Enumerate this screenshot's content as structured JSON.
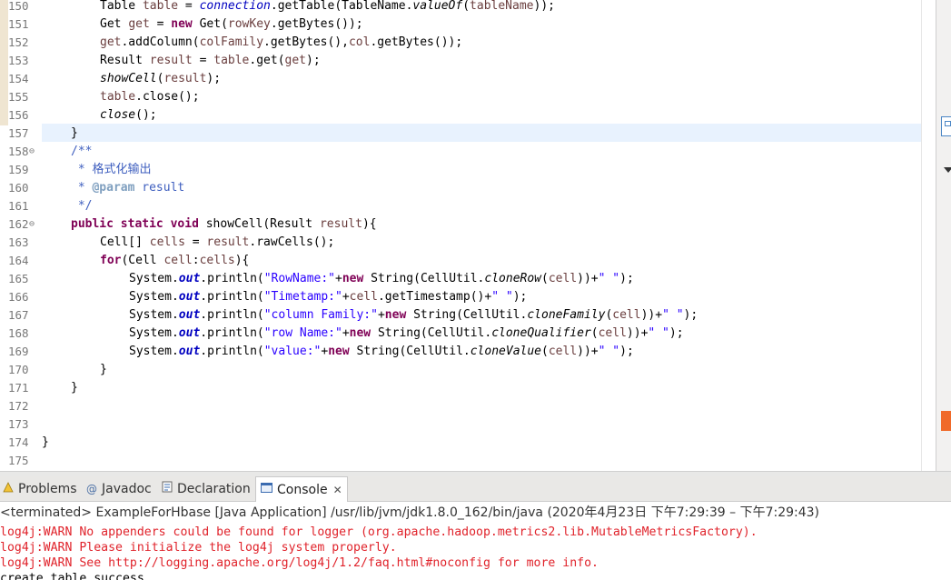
{
  "editor": {
    "lines": [
      {
        "n": "150",
        "fold": "",
        "indent": 2,
        "tokens": [
          [
            "Table ",
            "plain"
          ],
          [
            "table",
            "var"
          ],
          [
            " = ",
            "plain"
          ],
          [
            "connection",
            "static"
          ],
          [
            ".getTable(TableName.",
            "plain"
          ],
          [
            "valueOf",
            "italic"
          ],
          [
            "(",
            "plain"
          ],
          [
            "tableName",
            "var"
          ],
          [
            "));",
            "plain"
          ]
        ]
      },
      {
        "n": "151",
        "fold": "",
        "indent": 2,
        "tokens": [
          [
            "Get ",
            "plain"
          ],
          [
            "get",
            "var"
          ],
          [
            " = ",
            "plain"
          ],
          [
            "new",
            "kw"
          ],
          [
            " Get(",
            "plain"
          ],
          [
            "rowKey",
            "var"
          ],
          [
            ".getBytes());",
            "plain"
          ]
        ]
      },
      {
        "n": "152",
        "fold": "",
        "indent": 2,
        "tokens": [
          [
            "get",
            "var"
          ],
          [
            ".addColumn(",
            "plain"
          ],
          [
            "colFamily",
            "var"
          ],
          [
            ".getBytes(),",
            "plain"
          ],
          [
            "col",
            "var"
          ],
          [
            ".getBytes());",
            "plain"
          ]
        ]
      },
      {
        "n": "153",
        "fold": "",
        "indent": 2,
        "tokens": [
          [
            "Result ",
            "plain"
          ],
          [
            "result",
            "var"
          ],
          [
            " = ",
            "plain"
          ],
          [
            "table",
            "var"
          ],
          [
            ".get(",
            "plain"
          ],
          [
            "get",
            "var"
          ],
          [
            ");",
            "plain"
          ]
        ]
      },
      {
        "n": "154",
        "fold": "",
        "indent": 2,
        "tokens": [
          [
            "showCell",
            "italic"
          ],
          [
            "(",
            "plain"
          ],
          [
            "result",
            "var"
          ],
          [
            ");",
            "plain"
          ]
        ]
      },
      {
        "n": "155",
        "fold": "",
        "indent": 2,
        "tokens": [
          [
            "table",
            "var"
          ],
          [
            ".close();",
            "plain"
          ]
        ]
      },
      {
        "n": "156",
        "fold": "",
        "indent": 2,
        "tokens": [
          [
            "close",
            "italic"
          ],
          [
            "();",
            "plain"
          ]
        ]
      },
      {
        "n": "157",
        "fold": "",
        "indent": 1,
        "tokens": [
          [
            "}",
            "plain"
          ]
        ]
      },
      {
        "n": "158",
        "fold": "⊖",
        "indent": 1,
        "tokens": [
          [
            "/**",
            "comment"
          ]
        ]
      },
      {
        "n": "159",
        "fold": "",
        "indent": 1,
        "tokens": [
          [
            " * 格式化输出",
            "comment"
          ]
        ]
      },
      {
        "n": "160",
        "fold": "",
        "indent": 1,
        "tokens": [
          [
            " * ",
            "comment"
          ],
          [
            "@param",
            "param"
          ],
          [
            " result",
            "comment"
          ]
        ]
      },
      {
        "n": "161",
        "fold": "",
        "indent": 1,
        "tokens": [
          [
            " */",
            "comment"
          ]
        ]
      },
      {
        "n": "162",
        "fold": "⊖",
        "indent": 1,
        "tokens": [
          [
            "public",
            "kw"
          ],
          [
            " ",
            "plain"
          ],
          [
            "static",
            "kw"
          ],
          [
            " ",
            "plain"
          ],
          [
            "void",
            "kw"
          ],
          [
            " showCell(Result ",
            "plain"
          ],
          [
            "result",
            "var"
          ],
          [
            "){",
            "plain"
          ]
        ]
      },
      {
        "n": "163",
        "fold": "",
        "indent": 2,
        "tokens": [
          [
            "Cell[] ",
            "plain"
          ],
          [
            "cells",
            "var"
          ],
          [
            " = ",
            "plain"
          ],
          [
            "result",
            "var"
          ],
          [
            ".rawCells();",
            "plain"
          ]
        ]
      },
      {
        "n": "164",
        "fold": "",
        "indent": 2,
        "tokens": [
          [
            "for",
            "kw"
          ],
          [
            "(Cell ",
            "plain"
          ],
          [
            "cell",
            "var"
          ],
          [
            ":",
            "plain"
          ],
          [
            "cells",
            "var"
          ],
          [
            "){",
            "plain"
          ]
        ]
      },
      {
        "n": "165",
        "fold": "",
        "indent": 3,
        "tokens": [
          [
            "System.",
            "plain"
          ],
          [
            "out",
            "field"
          ],
          [
            ".println(",
            "plain"
          ],
          [
            "\"RowName:\"",
            "str"
          ],
          [
            "+",
            "plain"
          ],
          [
            "new",
            "kw"
          ],
          [
            " String(CellUtil.",
            "plain"
          ],
          [
            "cloneRow",
            "italic"
          ],
          [
            "(",
            "plain"
          ],
          [
            "cell",
            "var"
          ],
          [
            "))+",
            "plain"
          ],
          [
            "\" \"",
            "str"
          ],
          [
            ");",
            "plain"
          ]
        ]
      },
      {
        "n": "166",
        "fold": "",
        "indent": 3,
        "tokens": [
          [
            "System.",
            "plain"
          ],
          [
            "out",
            "field"
          ],
          [
            ".println(",
            "plain"
          ],
          [
            "\"Timetamp:\"",
            "str"
          ],
          [
            "+",
            "plain"
          ],
          [
            "cell",
            "var"
          ],
          [
            ".getTimestamp()+",
            "plain"
          ],
          [
            "\" \"",
            "str"
          ],
          [
            ");",
            "plain"
          ]
        ]
      },
      {
        "n": "167",
        "fold": "",
        "indent": 3,
        "tokens": [
          [
            "System.",
            "plain"
          ],
          [
            "out",
            "field"
          ],
          [
            ".println(",
            "plain"
          ],
          [
            "\"column Family:\"",
            "str"
          ],
          [
            "+",
            "plain"
          ],
          [
            "new",
            "kw"
          ],
          [
            " String(CellUtil.",
            "plain"
          ],
          [
            "cloneFamily",
            "italic"
          ],
          [
            "(",
            "plain"
          ],
          [
            "cell",
            "var"
          ],
          [
            "))+",
            "plain"
          ],
          [
            "\" \"",
            "str"
          ],
          [
            ");",
            "plain"
          ]
        ]
      },
      {
        "n": "168",
        "fold": "",
        "indent": 3,
        "tokens": [
          [
            "System.",
            "plain"
          ],
          [
            "out",
            "field"
          ],
          [
            ".println(",
            "plain"
          ],
          [
            "\"row Name:\"",
            "str"
          ],
          [
            "+",
            "plain"
          ],
          [
            "new",
            "kw"
          ],
          [
            " String(CellUtil.",
            "plain"
          ],
          [
            "cloneQualifier",
            "italic"
          ],
          [
            "(",
            "plain"
          ],
          [
            "cell",
            "var"
          ],
          [
            "))+",
            "plain"
          ],
          [
            "\" \"",
            "str"
          ],
          [
            ");",
            "plain"
          ]
        ]
      },
      {
        "n": "169",
        "fold": "",
        "indent": 3,
        "tokens": [
          [
            "System.",
            "plain"
          ],
          [
            "out",
            "field"
          ],
          [
            ".println(",
            "plain"
          ],
          [
            "\"value:\"",
            "str"
          ],
          [
            "+",
            "plain"
          ],
          [
            "new",
            "kw"
          ],
          [
            " String(CellUtil.",
            "plain"
          ],
          [
            "cloneValue",
            "italic"
          ],
          [
            "(",
            "plain"
          ],
          [
            "cell",
            "var"
          ],
          [
            "))+",
            "plain"
          ],
          [
            "\" \"",
            "str"
          ],
          [
            ");",
            "plain"
          ]
        ]
      },
      {
        "n": "170",
        "fold": "",
        "indent": 2,
        "tokens": [
          [
            "}",
            "plain"
          ]
        ]
      },
      {
        "n": "171",
        "fold": "",
        "indent": 1,
        "tokens": [
          [
            "}",
            "plain"
          ]
        ]
      },
      {
        "n": "172",
        "fold": "",
        "indent": 0,
        "tokens": []
      },
      {
        "n": "173",
        "fold": "",
        "indent": 0,
        "tokens": []
      },
      {
        "n": "174",
        "fold": "",
        "indent": 0,
        "tokens": [
          [
            "}",
            "plain"
          ]
        ]
      },
      {
        "n": "175",
        "fold": "",
        "indent": 0,
        "tokens": []
      }
    ]
  },
  "tabs": [
    {
      "label": "Problems",
      "icon": "problems-icon",
      "glyph": "⚠"
    },
    {
      "label": "Javadoc",
      "icon": "javadoc-icon",
      "glyph": "@"
    },
    {
      "label": "Declaration",
      "icon": "declaration-icon",
      "glyph": "▤"
    },
    {
      "label": "Console",
      "icon": "console-icon",
      "glyph": "▭",
      "active": true,
      "close": "✕"
    }
  ],
  "console": {
    "header": "<terminated> ExampleForHbase [Java Application] /usr/lib/jvm/jdk1.8.0_162/bin/java (2020年4月23日 下午7:29:39 – 下午7:29:43)",
    "lines": [
      {
        "text": "log4j:WARN No appenders could be found for logger (org.apache.hadoop.metrics2.lib.MutableMetricsFactory).",
        "kind": "warn"
      },
      {
        "text": "log4j:WARN Please initialize the log4j system properly.",
        "kind": "warn"
      },
      {
        "text": "log4j:WARN See http://logging.apache.org/log4j/1.2/faq.html#noconfig for more info.",
        "kind": "warn"
      },
      {
        "text": "create table success",
        "kind": "out"
      }
    ]
  },
  "colors": {
    "keyword": "#7f0055",
    "variable": "#6a3e3e",
    "string": "#2a00ff",
    "comment": "#3f5fbf",
    "warn": "#e0232b",
    "current_line": "#e8f2fe"
  }
}
